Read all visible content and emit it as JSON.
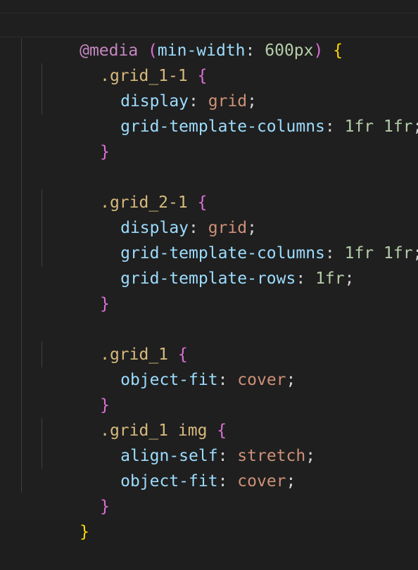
{
  "editor": {
    "colors": {
      "background": "#1f1f1f",
      "atrule": "#c586c0",
      "property": "#9cdcfe",
      "number": "#b5cea8",
      "value": "#ce9178",
      "selector": "#d7ba7d",
      "bracket_level1": "#ffd700",
      "bracket_level2": "#da70d6"
    },
    "lines": [
      {
        "at": "@media",
        "sp1": " ",
        "open_paren": "(",
        "feature": "min-width",
        "colon": ":",
        "sp2": " ",
        "num": "600px",
        "close_paren": ")",
        "sp3": " ",
        "brace": "{"
      },
      {
        "selector": ".grid_1-1",
        "sp": " ",
        "brace": "{"
      },
      {
        "prop": "display",
        "colon": ":",
        "sp": " ",
        "value": "grid",
        "semi": ";"
      },
      {
        "prop": "grid-template-columns",
        "colon": ":",
        "sp": " ",
        "value": "1fr 1fr",
        "semi": ";"
      },
      {
        "brace": "}"
      },
      {},
      {
        "selector": ".grid_2-1",
        "sp": " ",
        "brace": "{"
      },
      {
        "prop": "display",
        "colon": ":",
        "sp": " ",
        "value": "grid",
        "semi": ";"
      },
      {
        "prop": "grid-template-columns",
        "colon": ":",
        "sp": " ",
        "value": "1fr 1fr",
        "semi": ";"
      },
      {
        "prop": "grid-template-rows",
        "colon": ":",
        "sp": " ",
        "value": "1fr",
        "semi": ";"
      },
      {
        "brace": "}"
      },
      {},
      {
        "selector": ".grid_1",
        "sp": " ",
        "brace": "{"
      },
      {
        "prop": "object-fit",
        "colon": ":",
        "sp": " ",
        "value": "cover",
        "semi": ";"
      },
      {
        "brace": "}"
      },
      {
        "selector": ".grid_1 img",
        "sp": " ",
        "brace": "{"
      },
      {
        "prop": "align-self",
        "colon": ":",
        "sp": " ",
        "value": "stretch",
        "semi": ";"
      },
      {
        "prop": "object-fit",
        "colon": ":",
        "sp": " ",
        "value": "cover",
        "semi": ";"
      },
      {
        "brace": "}"
      },
      {
        "brace": "}"
      }
    ]
  }
}
